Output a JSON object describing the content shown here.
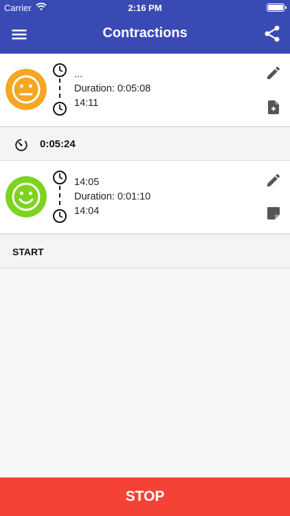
{
  "status_bar": {
    "carrier": "Carrier",
    "time": "2:16 PM"
  },
  "nav": {
    "title": "Contractions",
    "menu_icon": "menu-icon",
    "share_icon": "share-icon"
  },
  "entries": [
    {
      "face": "neutral-face-icon",
      "face_color": "#f5a623",
      "start": "...",
      "duration": "Duration: 0:05:08",
      "end": "14:11",
      "note_icon": "add-note-icon"
    },
    {
      "face": "smile-face-icon",
      "face_color": "#7ed321",
      "start": "14:05",
      "duration": "Duration: 0:01:10",
      "end": "14:04",
      "note_icon": "note-icon"
    }
  ],
  "interval": {
    "value": "0:05:24",
    "icon": "timer-icon"
  },
  "start_label": "START",
  "stop_label": "STOP",
  "colors": {
    "primary": "#3a4ab4",
    "stop": "#f44336"
  }
}
